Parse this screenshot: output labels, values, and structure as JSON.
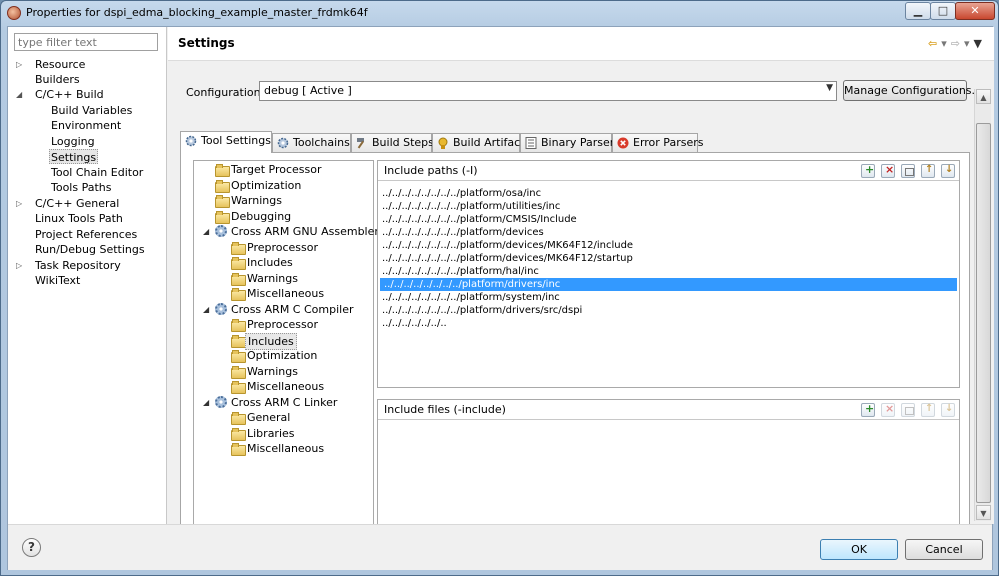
{
  "window": {
    "title": "Properties for dspi_edma_blocking_example_master_frdmk64f",
    "controls": {
      "minimize": "▁",
      "maximize": "□",
      "close": "✕"
    }
  },
  "sidebar": {
    "filter_placeholder": "type filter text",
    "items": [
      {
        "label": "Resource",
        "expander": "▷"
      },
      {
        "label": "Builders"
      },
      {
        "label": "C/C++ Build",
        "expander": "◢"
      },
      {
        "label": "Build Variables"
      },
      {
        "label": "Environment"
      },
      {
        "label": "Logging"
      },
      {
        "label": "Settings",
        "selected": true
      },
      {
        "label": "Tool Chain Editor"
      },
      {
        "label": "Tools Paths"
      },
      {
        "label": "C/C++ General",
        "expander": "▷"
      },
      {
        "label": "Linux Tools Path"
      },
      {
        "label": "Project References"
      },
      {
        "label": "Run/Debug Settings"
      },
      {
        "label": "Task Repository",
        "expander": "▷"
      },
      {
        "label": "WikiText"
      }
    ]
  },
  "header": {
    "title": "Settings",
    "nav": {
      "back": "⇦",
      "back_menu": "▾",
      "forward": "⇨",
      "forward_menu": "▾",
      "view_menu": "▼"
    }
  },
  "configuration": {
    "label": "Configuration:",
    "value": "debug  [ Active ]",
    "manage_button": "Manage Configurations..."
  },
  "tabs": [
    {
      "label": "Tool Settings",
      "active": true,
      "icon": "gear-icon"
    },
    {
      "label": "Toolchains",
      "icon": "gear-icon"
    },
    {
      "label": "Build Steps",
      "icon": "hammer-icon"
    },
    {
      "label": "Build Artifact",
      "icon": "artifact-icon"
    },
    {
      "label": "Binary Parsers",
      "icon": "binary-icon"
    },
    {
      "label": "Error Parsers",
      "icon": "error-icon"
    }
  ],
  "tool_tree": [
    {
      "label": "Target Processor",
      "kind": "folder"
    },
    {
      "label": "Optimization",
      "kind": "folder"
    },
    {
      "label": "Warnings",
      "kind": "folder"
    },
    {
      "label": "Debugging",
      "kind": "folder"
    },
    {
      "label": "Cross ARM GNU Assembler",
      "kind": "tool",
      "expander": "◢"
    },
    {
      "label": "Preprocessor",
      "kind": "folder"
    },
    {
      "label": "Includes",
      "kind": "folder"
    },
    {
      "label": "Warnings",
      "kind": "folder"
    },
    {
      "label": "Miscellaneous",
      "kind": "folder"
    },
    {
      "label": "Cross ARM C Compiler",
      "kind": "tool",
      "expander": "◢"
    },
    {
      "label": "Preprocessor",
      "kind": "folder"
    },
    {
      "label": "Includes",
      "kind": "folder",
      "selected": true
    },
    {
      "label": "Optimization",
      "kind": "folder"
    },
    {
      "label": "Warnings",
      "kind": "folder"
    },
    {
      "label": "Miscellaneous",
      "kind": "folder"
    },
    {
      "label": "Cross ARM C Linker",
      "kind": "tool",
      "expander": "◢"
    },
    {
      "label": "General",
      "kind": "folder"
    },
    {
      "label": "Libraries",
      "kind": "folder"
    },
    {
      "label": "Miscellaneous",
      "kind": "folder"
    }
  ],
  "include_paths": {
    "title": "Include paths (-I)",
    "items": [
      "../../../../../../../../platform/osa/inc",
      "../../../../../../../../platform/utilities/inc",
      "../../../../../../../../platform/CMSIS/Include",
      "../../../../../../../../platform/devices",
      "../../../../../../../../platform/devices/MK64F12/include",
      "../../../../../../../../platform/devices/MK64F12/startup",
      "../../../../../../../../platform/hal/inc",
      "../../../../../../../../platform/drivers/inc",
      "../../../../../../../../platform/system/inc",
      "../../../../../../../../platform/drivers/src/dspi",
      "../../../../../../.."
    ],
    "selected_index": 7
  },
  "include_files": {
    "title": "Include files (-include)",
    "items": []
  },
  "footer": {
    "help": "?",
    "ok": "OK",
    "cancel": "Cancel"
  },
  "colors": {
    "selection": "#3399ff",
    "window_frame": "#b4cbe2"
  }
}
